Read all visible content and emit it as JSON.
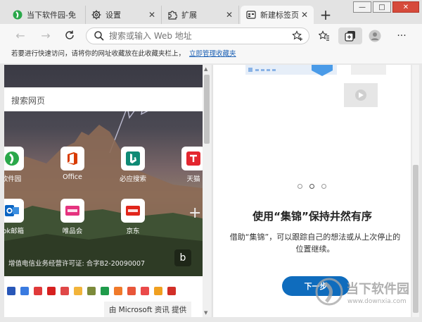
{
  "tabs": [
    {
      "label": "当下软件园-免",
      "icon": "downxia-logo-icon"
    },
    {
      "label": "设置",
      "icon": "gear-icon"
    },
    {
      "label": "扩展",
      "icon": "puzzle-icon"
    },
    {
      "label": "新建标签页",
      "icon": "newtab-page-icon"
    }
  ],
  "window_controls": {
    "minimize": "—",
    "maximize": "□",
    "close": "✕"
  },
  "address_bar": {
    "placeholder": "搜索或输入 Web 地址",
    "value": ""
  },
  "favorites_bar": {
    "prompt": "若要进行快速访问，请将你的网址收藏放在此收藏夹栏上，",
    "link": "立即管理收藏夹"
  },
  "newtab": {
    "search_placeholder": "搜索网页",
    "tiles": [
      {
        "label": "软件园"
      },
      {
        "label": "Office"
      },
      {
        "label": "必应搜索"
      },
      {
        "label": "天猫"
      },
      {
        "label": "ook邮箱"
      },
      {
        "label": "唯品会"
      },
      {
        "label": "京东"
      }
    ],
    "icp": "增值电信业务经营许可证: 合字B2-20090007",
    "provider": "由 Microsoft 资讯 提供"
  },
  "collections": {
    "title": "使用“集锦”保持井然有序",
    "description": "借助“集锦”，可以跟踪自己的想法或从上次停止的位置继续。",
    "next_button": "下一步",
    "current_step": 2,
    "total_steps": 3
  },
  "watermark": {
    "name": "当下软件园",
    "url": "www.downxia.com"
  },
  "colors": {
    "accent": "#0f6cbd",
    "tab_strip": "#e3e3e3",
    "toolbar": "#f7f7f7"
  }
}
